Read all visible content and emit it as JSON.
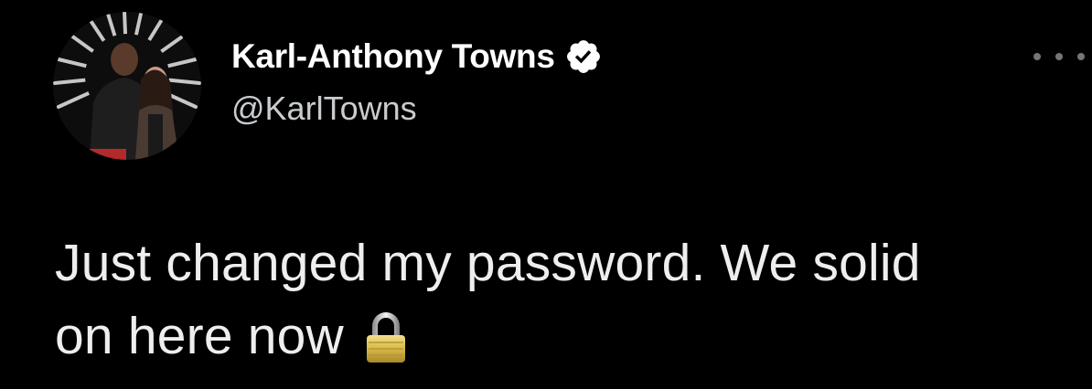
{
  "author": {
    "display_name": "Karl-Anthony Towns",
    "handle": "@KarlTowns",
    "verified": true
  },
  "tweet": {
    "line1": "Just changed my password. We solid",
    "line2": "on here now",
    "emoji": "lock-icon"
  },
  "icons": {
    "verified": "verified-badge-icon",
    "more": "more-options-icon",
    "lock": "lock-icon"
  },
  "colors": {
    "background": "#000000",
    "name": "#ffffff",
    "handle": "#c9ccce",
    "text": "#eeeeee",
    "more_dots": "#71767b"
  }
}
